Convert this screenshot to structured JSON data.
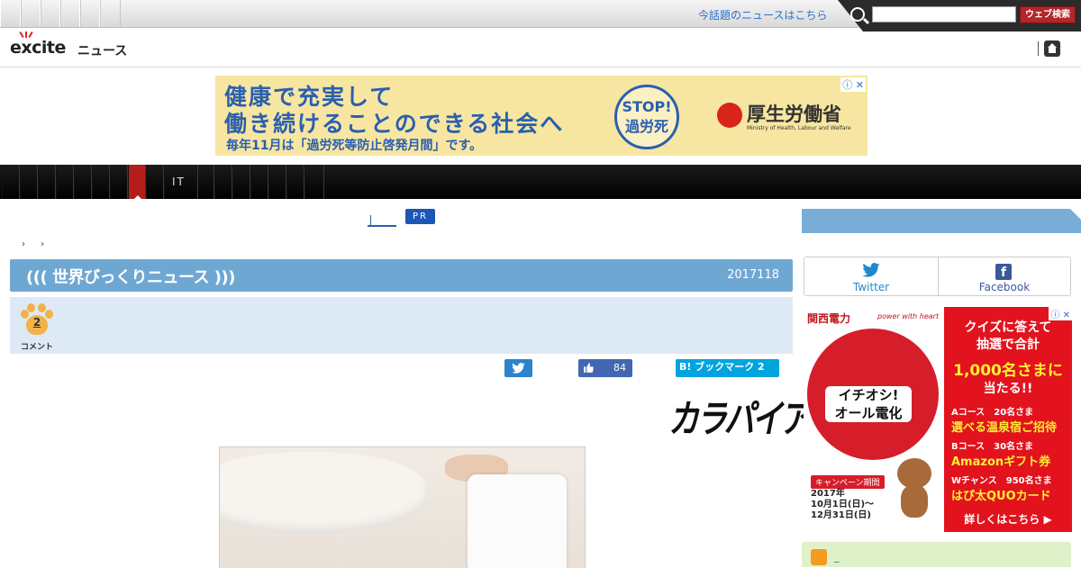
{
  "topbar": {
    "promo_link": "今話題のニュースはこちら",
    "search_placeholder": "",
    "search_button": "ウェブ検索"
  },
  "logo": {
    "brand": "excite",
    "news": "ニュース"
  },
  "banner": {
    "line1": "健康で充実して",
    "line2": "働き続けることのできる社会へ",
    "line3": "毎年11月は「過労死等防止啓発月間」です。",
    "stop_line1": "STOP!",
    "stop_line2": "過労死",
    "ministry": "厚生労働省",
    "ministry_en": "Ministry of Health, Labour and Welfare",
    "adchoice": "ⓘ ✕"
  },
  "nav": {
    "label": "IT"
  },
  "article": {
    "pr_badge": "PR",
    "crumbs": [
      "›",
      "›"
    ],
    "category_title": "((( 世界びっくりニュース )))",
    "date": "2017118",
    "comment_count": "2",
    "comment_label": "コメント",
    "like_count": "84",
    "hatena_label": "B! ブックマーク 2",
    "source_logo": "カラパイア"
  },
  "sidebar": {
    "twitter_label": "Twitter",
    "facebook_label": "Facebook",
    "green_text": "_",
    "ad": {
      "brand": "関西電力",
      "brand_sub": "power with heart",
      "circle_text": "イチオシ!\nオール電化",
      "period_tag": "キャンペーン期間",
      "period": "2017年\n10月1日(日)～\n12月31日(日)",
      "r1": "クイズに答えて\n抽選で合計",
      "r2": "1,000名さまに",
      "r3": "当たる!!",
      "course_a": "Aコース　20名さま",
      "course_a_sub": "選べる温泉宿ご招待",
      "course_b": "Bコース　30名さま",
      "course_b_sub": "Amazonギフト券",
      "course_w": "Wチャンス　950名さま",
      "course_w_sub": "はぴ太QUOカード",
      "more": "詳しくはこちら ▶",
      "adx": "ⓘ ✕"
    }
  },
  "colors": {
    "accent_blue": "#6fa7d3",
    "nav_active": "#b51d1d",
    "search_button": "#b3262a"
  }
}
